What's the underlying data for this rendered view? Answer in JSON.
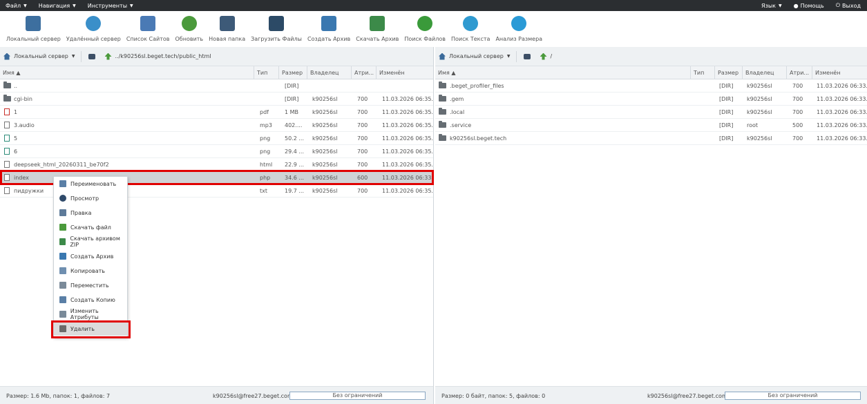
{
  "menubar": {
    "file": "Файл",
    "nav": "Навигация",
    "tools": "Инструменты",
    "lang": "Язык",
    "help": "Помощь",
    "exit": "Выход"
  },
  "toolbar": [
    {
      "label": "Локальный сервер",
      "icon": "home-icon",
      "color": "#3d6f9f"
    },
    {
      "label": "Удалённый сервер",
      "icon": "globe-icon",
      "color": "#3a8fc9"
    },
    {
      "label": "Список Сайтов",
      "icon": "sites-icon",
      "color": "#4a7ab5"
    },
    {
      "label": "Обновить",
      "icon": "refresh-icon",
      "color": "#4b9a3c"
    },
    {
      "label": "Новая папка",
      "icon": "new-folder-icon",
      "color": "#3d5a78"
    },
    {
      "label": "Загрузить Файлы",
      "icon": "upload-icon",
      "color": "#2c4a66"
    },
    {
      "label": "Создать Архив",
      "icon": "archive-icon",
      "color": "#3a78b0"
    },
    {
      "label": "Скачать Архив",
      "icon": "download-archive-icon",
      "color": "#3c8a49"
    },
    {
      "label": "Поиск Файлов",
      "icon": "search-files-icon",
      "color": "#3a9a3a"
    },
    {
      "label": "Поиск Текста",
      "icon": "search-text-icon",
      "color": "#2f9ad0"
    },
    {
      "label": "Анализ Размера",
      "icon": "size-chart-icon",
      "color": "#2a9ad6"
    }
  ],
  "left": {
    "server": "Локальный сервер",
    "path": "../k90256sl.beget.tech/public_html",
    "headers": {
      "name": "Имя",
      "type": "Тип",
      "size": "Размер",
      "owner": "Владелец",
      "attr": "Атри...",
      "mod": "Изменён"
    },
    "rows": [
      {
        "name": "..",
        "type": "",
        "size": "[DIR]",
        "owner": "",
        "attr": "",
        "mod": ""
      },
      {
        "name": "cgi-bin",
        "type": "",
        "size": "[DIR]",
        "owner": "k90256sl",
        "attr": "700",
        "mod": "11.03.2026 06:35..."
      },
      {
        "name": "1",
        "type": "pdf",
        "size": "1 MB",
        "owner": "k90256sl",
        "attr": "700",
        "mod": "11.03.2026 06:35..."
      },
      {
        "name": "3.audio",
        "type": "mp3",
        "size": "402....",
        "owner": "k90256sl",
        "attr": "700",
        "mod": "11.03.2026 06:35..."
      },
      {
        "name": "5",
        "type": "png",
        "size": "50.2 ...",
        "owner": "k90256sl",
        "attr": "700",
        "mod": "11.03.2026 06:35..."
      },
      {
        "name": "6",
        "type": "png",
        "size": "29.4 ...",
        "owner": "k90256sl",
        "attr": "700",
        "mod": "11.03.2026 06:35..."
      },
      {
        "name": "deepseek_html_20260311_be70f2",
        "type": "html",
        "size": "22.9 ...",
        "owner": "k90256sl",
        "attr": "700",
        "mod": "11.03.2026 06:35..."
      },
      {
        "name": "index",
        "type": "php",
        "size": "34.6 ...",
        "owner": "k90256sl",
        "attr": "600",
        "mod": "11.03.2026 06:33..."
      },
      {
        "name": "пидружки",
        "type": "txt",
        "size": "19.7 ...",
        "owner": "k90256sl",
        "attr": "700",
        "mod": "11.03.2026 06:35..."
      }
    ],
    "status": "Размер: 1.6 Mb, папок: 1, файлов: 7",
    "user": "k90256sl@free27.beget.com",
    "limit": "Без ограничений"
  },
  "right": {
    "server": "Локальный сервер",
    "path": "/",
    "headers": {
      "name": "Имя",
      "type": "Тип",
      "size": "Размер",
      "owner": "Владелец",
      "attr": "Атри...",
      "mod": "Изменён"
    },
    "rows": [
      {
        "name": ".beget_profiler_files",
        "size": "[DIR]",
        "owner": "k90256sl",
        "attr": "700",
        "mod": "11.03.2026 06:33..."
      },
      {
        "name": ".gem",
        "size": "[DIR]",
        "owner": "k90256sl",
        "attr": "700",
        "mod": "11.03.2026 06:33..."
      },
      {
        "name": ".local",
        "size": "[DIR]",
        "owner": "k90256sl",
        "attr": "700",
        "mod": "11.03.2026 06:33..."
      },
      {
        "name": ".service",
        "size": "[DIR]",
        "owner": "root",
        "attr": "500",
        "mod": "11.03.2026 06:33..."
      },
      {
        "name": "k90256sl.beget.tech",
        "size": "[DIR]",
        "owner": "k90256sl",
        "attr": "700",
        "mod": "11.03.2026 06:33..."
      }
    ],
    "status": "Размер: 0 байт, папок: 5, файлов: 0",
    "user": "k90256sl@free27.beget.com",
    "limit": "Без ограничений"
  },
  "context_menu": [
    {
      "label": "Переименовать",
      "color": "#5a7fa6"
    },
    {
      "label": "Просмотр",
      "color": "#2f4a6a"
    },
    {
      "label": "Правка",
      "color": "#5d7a99"
    },
    {
      "label": "Скачать файл",
      "color": "#4b9a3c"
    },
    {
      "label": "Скачать архивом ZIP",
      "color": "#3c8a49"
    },
    {
      "label": "Создать Архив",
      "color": "#3a78b0"
    },
    {
      "label": "Копировать",
      "color": "#6f8fb0"
    },
    {
      "label": "Переместить",
      "color": "#7a8a99"
    },
    {
      "label": "Создать Копию",
      "color": "#5a7fa6"
    },
    {
      "label": "Изменить Атрибуты",
      "color": "#7a8a99"
    },
    {
      "label": "Удалить",
      "color": "#6b6b6b"
    }
  ]
}
